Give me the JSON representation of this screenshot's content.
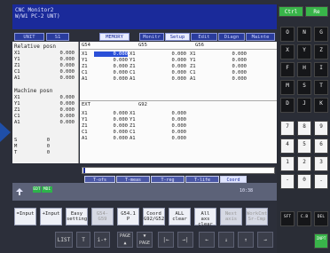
{
  "header": {
    "line1": "CNC Monitor2",
    "line2": "W/W1 PC-2 UNT)"
  },
  "tabs": [
    {
      "label": "UNIT",
      "active": false
    },
    {
      "label": "S1",
      "active": false
    },
    {
      "label": "MEMORY",
      "active": true
    },
    {
      "label": "Monitr",
      "active": false
    },
    {
      "label": "Setup",
      "active": true
    },
    {
      "label": "Edit",
      "active": false
    },
    {
      "label": "Diagn",
      "active": false
    },
    {
      "label": "Mainte",
      "active": false
    }
  ],
  "left_panel": {
    "relative_title": "Relative posn",
    "relative": [
      {
        "axis": "X1",
        "value": "0.000"
      },
      {
        "axis": "Y1",
        "value": "0.000"
      },
      {
        "axis": "Z1",
        "value": "0.000"
      },
      {
        "axis": "C1",
        "value": "0.000"
      },
      {
        "axis": "A1",
        "value": "0.000"
      }
    ],
    "machine_title": "Machine posn",
    "machine": [
      {
        "axis": "X1",
        "value": "0.000"
      },
      {
        "axis": "Y1",
        "value": "0.000"
      },
      {
        "axis": "Z1",
        "value": "0.000"
      },
      {
        "axis": "C1",
        "value": "0.000"
      },
      {
        "axis": "A1",
        "value": "0.000"
      }
    ],
    "extra": [
      {
        "axis": "S",
        "value": "0"
      },
      {
        "axis": "M",
        "value": "0"
      },
      {
        "axis": "T",
        "value": "0"
      }
    ]
  },
  "main": {
    "col_headers": [
      "G54",
      "G55",
      "G56"
    ],
    "rows_top": [
      {
        "a1": "X1",
        "v1": "0.000",
        "a2": "X1",
        "v2": "0.000",
        "a3": "X1",
        "v3": "0.000"
      },
      {
        "a1": "Y1",
        "v1": "0.000",
        "a2": "Y1",
        "v2": "0.000",
        "a3": "Y1",
        "v3": "0.000"
      },
      {
        "a1": "Z1",
        "v1": "0.000",
        "a2": "Z1",
        "v2": "0.000",
        "a3": "Z1",
        "v3": "0.000"
      },
      {
        "a1": "C1",
        "v1": "0.000",
        "a2": "C1",
        "v2": "0.000",
        "a3": "C1",
        "v3": "0.000"
      },
      {
        "a1": "A1",
        "v1": "0.000",
        "a2": "A1",
        "v2": "0.000",
        "a3": "A1",
        "v3": "0.000"
      }
    ],
    "col_headers2": [
      "EXT",
      "G92"
    ],
    "rows_bottom": [
      {
        "a1": "X1",
        "v1": "0.000",
        "a2": "X1",
        "v2": "0.000"
      },
      {
        "a1": "Y1",
        "v1": "0.000",
        "a2": "Y1",
        "v2": "0.000"
      },
      {
        "a1": "Z1",
        "v1": "0.000",
        "a2": "Z1",
        "v2": "0.000"
      },
      {
        "a1": "C1",
        "v1": "0.000",
        "a2": "C1",
        "v2": "0.000"
      },
      {
        "a1": "A1",
        "v1": "0.000",
        "a2": "A1",
        "v2": "0.000"
      }
    ]
  },
  "sub_tabs": [
    "T-ofs",
    "T-meas",
    "T-reg",
    "T-life",
    "Coord"
  ],
  "status": {
    "badge1": "EDT",
    "badge2": "MDI",
    "time": "10:38"
  },
  "softkeys": [
    {
      "label": "=Input",
      "enabled": true
    },
    {
      "label": "+Input",
      "enabled": true
    },
    {
      "label": "Easy setting",
      "enabled": true
    },
    {
      "label": "G54-G59",
      "enabled": false
    },
    {
      "label": "G54.1 P",
      "enabled": true
    },
    {
      "label": "Coord G92/G52",
      "enabled": true
    },
    {
      "label": "ALL clear",
      "enabled": true
    },
    {
      "label": "All axs clear",
      "enabled": true
    },
    {
      "label": "Next axis",
      "enabled": false
    },
    {
      "label": "WorkCmt Sr-Cmp",
      "enabled": false
    }
  ],
  "nav_buttons": [
    "LIST",
    "T",
    "i-+",
    "PAGE",
    "PAGE",
    "|←",
    "→|",
    "←",
    "↓",
    "↑",
    "→"
  ],
  "keypad": {
    "top_labels": [
      "Ctrl",
      "Re"
    ],
    "rows": [
      [
        "O",
        "N",
        "G"
      ],
      [
        "X",
        "Y",
        "Z"
      ],
      [
        "F",
        "H",
        "I"
      ],
      [
        "M",
        "S",
        "T"
      ],
      [
        "D",
        "J",
        "K"
      ],
      [
        "7",
        "8",
        "9"
      ],
      [
        "4",
        "5",
        "6"
      ],
      [
        "1",
        "2",
        "3"
      ],
      [
        "-",
        "0",
        "."
      ],
      [
        "SFT",
        "C.B",
        "DEL"
      ]
    ],
    "input_label": "INPT"
  }
}
